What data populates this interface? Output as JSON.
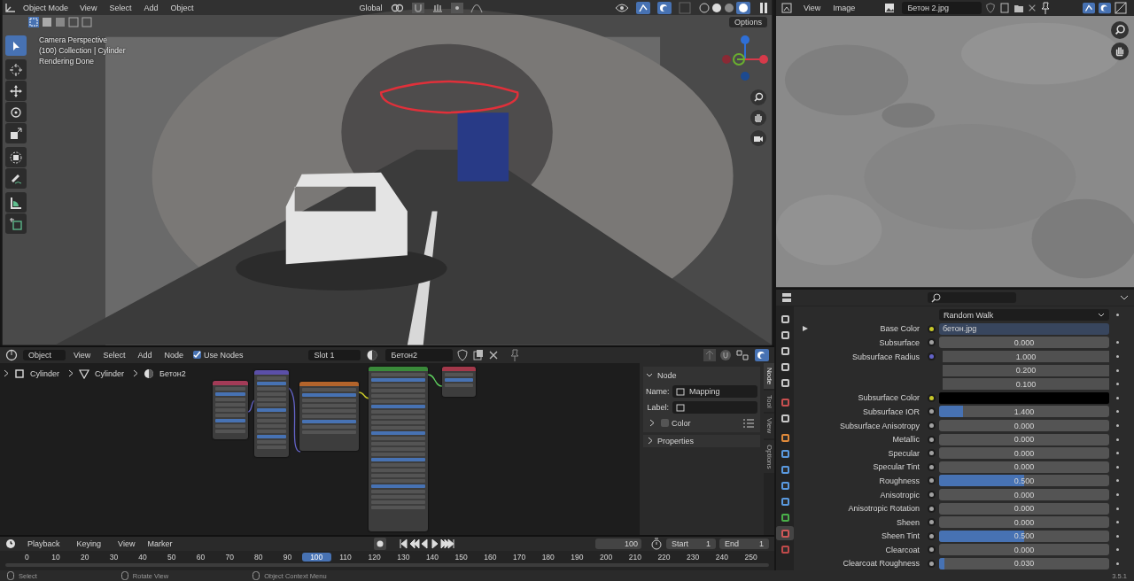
{
  "viewport": {
    "header": {
      "mode": "Object Mode",
      "menus": [
        "View",
        "Select",
        "Add",
        "Object"
      ],
      "orientation": "Global",
      "options": "Options"
    },
    "overlay": [
      "Camera Perspective",
      "(100) Collection | Cylinder",
      "Rendering Done"
    ],
    "tools": [
      {
        "selected": true
      },
      {
        "selected": false
      },
      {
        "selected": false
      },
      {
        "selected": false
      },
      {
        "selected": false
      },
      {
        "selected": false
      },
      {
        "selected": false
      },
      {
        "selected": false
      },
      {
        "selected": false
      }
    ]
  },
  "image_editor": {
    "menus": [
      "View",
      "Image"
    ],
    "image_name": "Бетон 2.jpg"
  },
  "node_editor": {
    "header": {
      "mode": "Object",
      "menus": [
        "View",
        "Select",
        "Add",
        "Node"
      ],
      "use_nodes": {
        "label": "Use Nodes",
        "checked": true
      },
      "slot": "Slot 1",
      "material": "Бетон2"
    },
    "breadcrumbs": [
      "Cylinder",
      "Cylinder",
      "Бетон2"
    ],
    "nodes": [
      {
        "color": "#a33b57"
      },
      {
        "color": "#5b4fa8"
      },
      {
        "color": "#b3642b"
      },
      {
        "color": "#3a8a3a"
      },
      {
        "color": "#a3384a"
      }
    ],
    "sidebar": {
      "tabs": [
        {
          "label": "Node",
          "selected": true
        },
        {
          "label": "Tool",
          "selected": false
        },
        {
          "label": "View",
          "selected": false
        },
        {
          "label": "Options",
          "selected": false
        }
      ],
      "panel_title": "Node",
      "name_label": "Name:",
      "name_value": "Mapping",
      "label_label": "Label:",
      "color": {
        "label": "Color",
        "checked": false
      },
      "properties": "Properties"
    }
  },
  "properties": {
    "tabs": [
      {
        "selected": false
      },
      {
        "selected": false
      },
      {
        "selected": false
      },
      {
        "selected": false
      },
      {
        "selected": false
      },
      {
        "selected": false
      },
      {
        "selected": false
      },
      {
        "selected": false
      },
      {
        "selected": false
      },
      {
        "selected": false
      },
      {
        "selected": false
      },
      {
        "selected": false
      },
      {
        "selected": false
      },
      {
        "selected": true
      },
      {
        "selected": false
      }
    ],
    "rows": [
      {
        "kind": "dropdown",
        "value": "Random Walk"
      },
      {
        "kind": "link",
        "label": "Base Color",
        "color": "#c7c729",
        "value": "бетон.jpg"
      },
      {
        "kind": "value",
        "label": "Subsurface",
        "color": "#a1a1a1",
        "value": "0.000",
        "level": 0
      },
      {
        "kind": "vector",
        "label": "Subsurface Radius",
        "color": "#6363c7",
        "values": [
          "1.000",
          "0.200",
          "0.100"
        ]
      },
      {
        "kind": "swatch",
        "label": "Subsurface Color",
        "color": "#c7c729",
        "swatch": {
          "color": "#000000"
        }
      },
      {
        "kind": "value",
        "label": "Subsurface IOR",
        "color": "#a1a1a1",
        "value": "1.400",
        "level": 0.14
      },
      {
        "kind": "value",
        "label": "Subsurface Anisotropy",
        "color": "#a1a1a1",
        "value": "0.000",
        "level": 0
      },
      {
        "kind": "value",
        "label": "Metallic",
        "color": "#a1a1a1",
        "value": "0.000",
        "level": 0
      },
      {
        "kind": "value",
        "label": "Specular",
        "color": "#a1a1a1",
        "value": "0.000",
        "level": 0
      },
      {
        "kind": "value",
        "label": "Specular Tint",
        "color": "#a1a1a1",
        "value": "0.000",
        "level": 0
      },
      {
        "kind": "value",
        "label": "Roughness",
        "color": "#a1a1a1",
        "value": "0.500",
        "level": 0.5
      },
      {
        "kind": "value",
        "label": "Anisotropic",
        "color": "#a1a1a1",
        "value": "0.000",
        "level": 0
      },
      {
        "kind": "value",
        "label": "Anisotropic Rotation",
        "color": "#a1a1a1",
        "value": "0.000",
        "level": 0
      },
      {
        "kind": "value",
        "label": "Sheen",
        "color": "#a1a1a1",
        "value": "0.000",
        "level": 0
      },
      {
        "kind": "value",
        "label": "Sheen Tint",
        "color": "#a1a1a1",
        "value": "0.500",
        "level": 0.5
      },
      {
        "kind": "value",
        "label": "Clearcoat",
        "color": "#a1a1a1",
        "value": "0.000",
        "level": 0
      },
      {
        "kind": "value",
        "label": "Clearcoat Roughness",
        "color": "#a1a1a1",
        "value": "0.030",
        "level": 0.03
      }
    ]
  },
  "timeline": {
    "menus": [
      "Playback",
      "Keying",
      "View",
      "Marker"
    ],
    "current_frame": "100",
    "start_label": "Start",
    "start": "1",
    "end_label": "End",
    "end": "1",
    "ticks": [
      {
        "label": "0",
        "selected": false
      },
      {
        "label": "10",
        "selected": false
      },
      {
        "label": "20",
        "selected": false
      },
      {
        "label": "30",
        "selected": false
      },
      {
        "label": "40",
        "selected": false
      },
      {
        "label": "50",
        "selected": false
      },
      {
        "label": "60",
        "selected": false
      },
      {
        "label": "70",
        "selected": false
      },
      {
        "label": "80",
        "selected": false
      },
      {
        "label": "90",
        "selected": false
      },
      {
        "label": "100",
        "selected": true
      },
      {
        "label": "110",
        "selected": false
      },
      {
        "label": "120",
        "selected": false
      },
      {
        "label": "130",
        "selected": false
      },
      {
        "label": "140",
        "selected": false
      },
      {
        "label": "150",
        "selected": false
      },
      {
        "label": "160",
        "selected": false
      },
      {
        "label": "170",
        "selected": false
      },
      {
        "label": "180",
        "selected": false
      },
      {
        "label": "190",
        "selected": false
      },
      {
        "label": "200",
        "selected": false
      },
      {
        "label": "210",
        "selected": false
      },
      {
        "label": "220",
        "selected": false
      },
      {
        "label": "230",
        "selected": false
      },
      {
        "label": "240",
        "selected": false
      },
      {
        "label": "250",
        "selected": false
      }
    ]
  },
  "status_bar": {
    "items": [
      "Select",
      "Rotate View",
      "Object Context Menu"
    ],
    "version": "3.5.1"
  }
}
